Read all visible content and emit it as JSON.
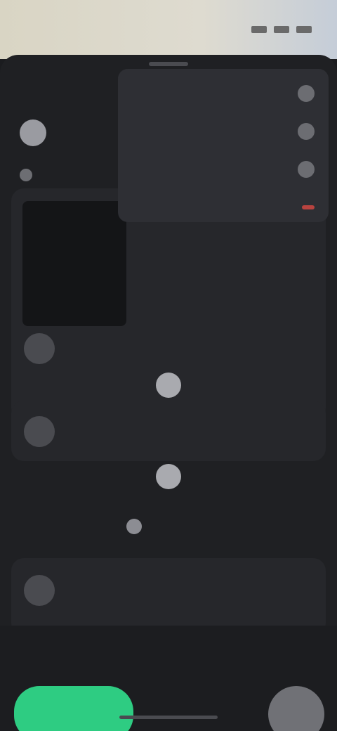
{
  "status_bar": {
    "time": ""
  },
  "header": {
    "profile_name": "",
    "action_label": ""
  },
  "section": {
    "label": ""
  },
  "card_1": {
    "title": "",
    "subtitle": ""
  },
  "menu": {
    "items": [
      {
        "label": "",
        "icon": "circle-icon"
      },
      {
        "label": "",
        "icon": "circle-icon"
      },
      {
        "label": "",
        "icon": "circle-icon"
      },
      {
        "label": "",
        "icon": "minus-icon",
        "danger": true
      }
    ]
  },
  "card_2": {
    "title": "",
    "subtitle": ""
  },
  "add_row": {
    "label": ""
  },
  "card_3": {
    "title": "",
    "subtitle": ""
  },
  "bottom_bar": {
    "primary_label": "",
    "secondary_label": ""
  },
  "colors": {
    "background": "#1b1c1f",
    "card": "#26272b",
    "accent_link": "#48a8c0",
    "primary": "#2ecc82",
    "danger": "#d9534f"
  }
}
